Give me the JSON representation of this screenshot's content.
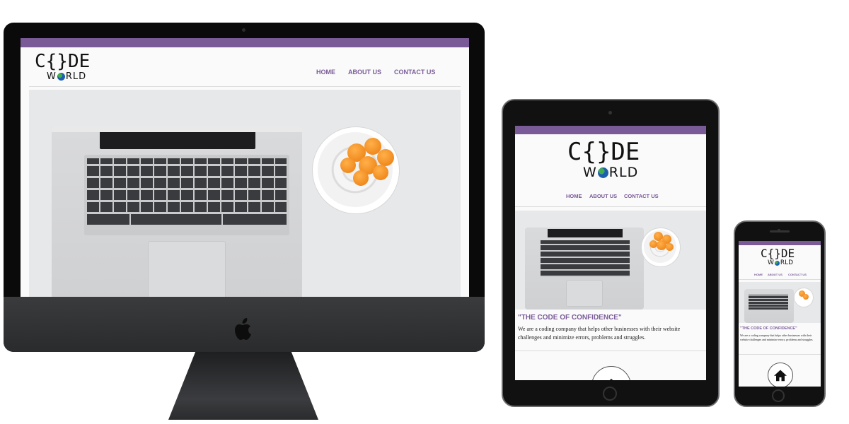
{
  "site": {
    "logo_top": "C{}DE",
    "logo_bottom_pre": "W",
    "logo_bottom_post": "RLD",
    "nav": [
      "HOME",
      "ABOUT US",
      "CONTACT US"
    ],
    "tagline": "\"THE CODE OF CONFIDENCE\"",
    "description": "We are a coding company that helps other businesses with their website challenges and minimize errors, problems and struggles."
  },
  "icons": {
    "apple": "apple-logo-icon",
    "home": "home-icon"
  },
  "colors": {
    "brand_purple": "#7a5b97",
    "device_dark": "#2a2b2d",
    "flower_orange": "#f08a1e"
  }
}
